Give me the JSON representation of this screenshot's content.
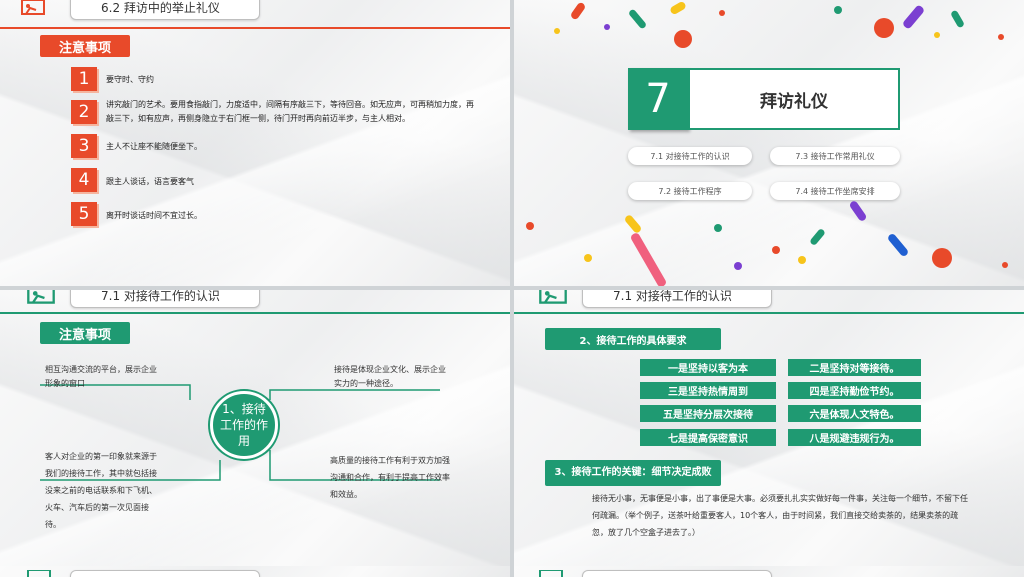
{
  "slide1": {
    "title": "6.2 拜访中的举止礼仪",
    "tag": "注意事项",
    "items": [
      {
        "num": "1",
        "text": "要守时、守约"
      },
      {
        "num": "2",
        "text": "讲究敲门的艺术。要用食指敲门，力度适中，间隔有序敲三下，等待回音。如无应声，可再稍加力度，再敲三下，如有应声，再侧身隐立于右门框一侧，待门开时再向前迈半步，与主人相对。"
      },
      {
        "num": "3",
        "text": "主人不让座不能随便坐下。"
      },
      {
        "num": "4",
        "text": "跟主人谈话，语言要客气"
      },
      {
        "num": "5",
        "text": "离开时谈话时间不宜过长。"
      }
    ]
  },
  "slide2": {
    "number": "7",
    "chapter_title": "拜访礼仪",
    "sections": [
      "7.1  对接待工作的认识",
      "7.3  接待工作常用礼仪",
      "7.2  接待工作程序",
      "7.4  接待工作坐席安排"
    ]
  },
  "slide3": {
    "title": "7.1 对接待工作的认识",
    "tag": "注意事项",
    "center": "1、接待工作的作用",
    "left_top": "相互沟通交流的平台，展示企业形象的窗口",
    "left_bottom": "客人对企业的第一印象就来源于我们的接待工作，其中就包括接没来之前的电话联系和下飞机、火车、汽车后的第一次见面接待。",
    "right_top": "接待是体现企业文化、展示企业实力的一种途径。",
    "right_bottom": "高质量的接待工作有利于双方加强沟通和合作，有利于提高工作效率和效益。"
  },
  "slide4": {
    "title": "7.1 对接待工作的认识",
    "section2": "2、接待工作的具体要求",
    "requirements": [
      "一是坚持以客为本",
      "二是坚持对等接待。",
      "三是坚持热情周到",
      "四是坚持勤俭节约。",
      "五是坚持分层次接待",
      "六是体现人文特色。",
      "七是提高保密意识",
      "八是规避违规行为。"
    ],
    "section3": "3、接待工作的关键：细节决定成败",
    "body": "接待无小事，无事便是小事，出了事便是大事。必须要扎扎实实做好每一件事，关注每一个细节，不留下任何疏漏。（举个例子，送茶叶给重要客人，10个客人，由于时间紧，我们直接交给卖茶的，结果卖茶的疏忽，放了几个空盒子进去了。）"
  },
  "colors": {
    "accent_red": "#e84a2a",
    "accent_green": "#1f9a72"
  }
}
